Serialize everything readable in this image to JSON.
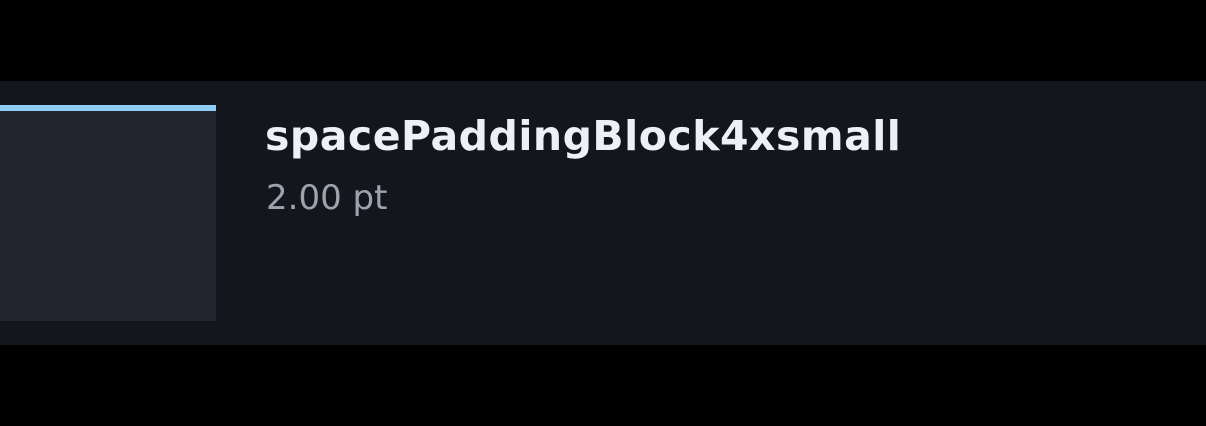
{
  "token": {
    "name": "spacePaddingBlock4xsmall",
    "value": "2.00 pt",
    "swatch_indicator_color": "#8ecdf6",
    "swatch_color": "#22252d",
    "card_color": "#13161c"
  }
}
